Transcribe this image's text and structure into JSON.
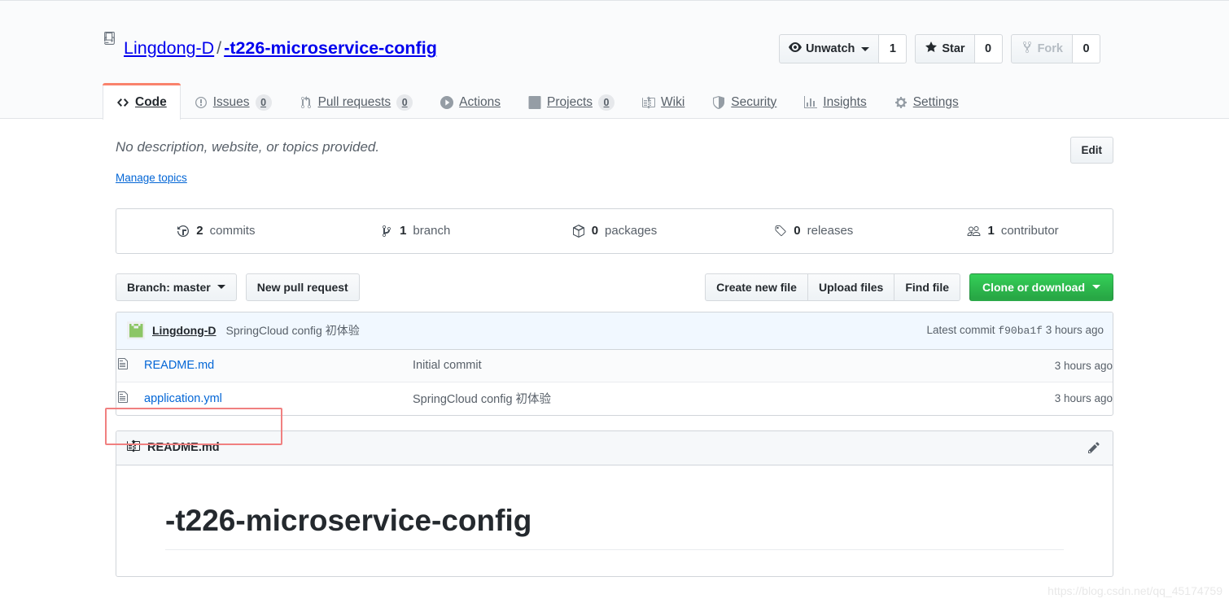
{
  "header": {
    "repo_icon": "repo-book-icon",
    "owner": "Lingdong-D",
    "separator": "/",
    "repo_name": "-t226-microservice-config",
    "actions": [
      {
        "icon": "eye-icon",
        "label": "Unwatch",
        "count": "1",
        "has_caret": true,
        "disabled": false
      },
      {
        "icon": "star-icon",
        "label": "Star",
        "count": "0",
        "has_caret": false,
        "disabled": false
      },
      {
        "icon": "fork-icon",
        "label": "Fork",
        "count": "0",
        "has_caret": false,
        "disabled": true
      }
    ]
  },
  "nav": {
    "selected_color": "#f9826c",
    "tabs": [
      {
        "icon": "code-icon",
        "label": "Code",
        "count": null,
        "selected": true
      },
      {
        "icon": "issue-opened-icon",
        "label": "Issues",
        "count": "0",
        "selected": false
      },
      {
        "icon": "git-pull-request-icon",
        "label": "Pull requests",
        "count": "0",
        "selected": false
      },
      {
        "icon": "play-icon",
        "label": "Actions",
        "count": null,
        "selected": false
      },
      {
        "icon": "project-icon",
        "label": "Projects",
        "count": "0",
        "selected": false
      },
      {
        "icon": "book-icon",
        "label": "Wiki",
        "count": null,
        "selected": false
      },
      {
        "icon": "shield-icon",
        "label": "Security",
        "count": null,
        "selected": false
      },
      {
        "icon": "graph-icon",
        "label": "Insights",
        "count": null,
        "selected": false
      },
      {
        "icon": "gear-icon",
        "label": "Settings",
        "count": null,
        "selected": false
      }
    ]
  },
  "about": {
    "description": "No description, website, or topics provided.",
    "manage_topics_label": "Manage topics",
    "edit_label": "Edit"
  },
  "summary": [
    {
      "icon": "history-icon",
      "num": "2",
      "label": "commits"
    },
    {
      "icon": "branch-icon",
      "num": "1",
      "label": "branch"
    },
    {
      "icon": "package-icon",
      "num": "0",
      "label": "packages"
    },
    {
      "icon": "tag-icon",
      "num": "0",
      "label": "releases"
    },
    {
      "icon": "people-icon",
      "num": "1",
      "label": "contributor"
    }
  ],
  "toolbar": {
    "branch_label": "Branch: master",
    "new_pull_request_label": "New pull request",
    "create_new_file_label": "Create new file",
    "upload_files_label": "Upload files",
    "find_file_label": "Find file",
    "clone_label": "Clone or download",
    "clone_color": "#28a745"
  },
  "commit_tease": {
    "avatar": "identicon-avatar",
    "author": "Lingdong-D",
    "message": "SpringCloud config 初体验",
    "latest_commit_label": "Latest commit",
    "sha": "f90ba1f",
    "age": "3 hours ago"
  },
  "files": {
    "columns": [
      "name",
      "message",
      "age"
    ],
    "rows": [
      {
        "icon": "file-icon",
        "name": "README.md",
        "message": "Initial commit",
        "age": "3 hours ago",
        "highlighted": false
      },
      {
        "icon": "file-icon",
        "name": "application.yml",
        "message": "SpringCloud config 初体验",
        "age": "3 hours ago",
        "highlighted": true
      }
    ]
  },
  "readme": {
    "icon": "book-icon",
    "title": "README.md",
    "edit_icon": "pencil-icon",
    "heading": "-t226-microservice-config"
  },
  "annotation": {
    "color": "#f08080",
    "target": "application.yml"
  },
  "watermark": "https://blog.csdn.net/qq_45174759"
}
